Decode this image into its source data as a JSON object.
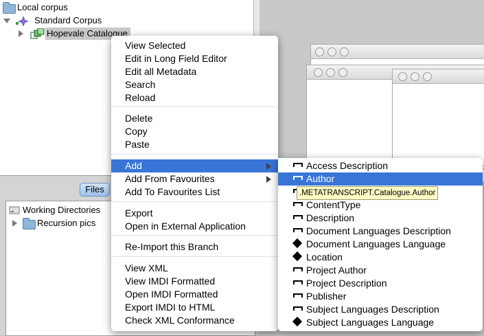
{
  "tree": {
    "root_label": "Local corpus",
    "corpus_label": "Standard Corpus",
    "catalogue_label": "Hopevale Catalogue"
  },
  "files": {
    "tab_label": "Files",
    "working_dirs_label": "Working Directories",
    "recursion_label": "Recursion pics"
  },
  "context_menu": {
    "groups": [
      [
        "View Selected",
        "Edit in Long Field Editor",
        "Edit all Metadata",
        "Search",
        "Reload"
      ],
      [
        "Delete",
        "Copy",
        "Paste"
      ],
      [
        "Add",
        "Add From Favourites",
        "Add To Favourites List"
      ],
      [
        "Export",
        "Open in External Application"
      ],
      [
        "Re-Import this Branch"
      ],
      [
        "View XML",
        "View IMDI Formatted",
        "Open IMDI Formatted",
        "Export IMDI to HTML",
        "Check XML Conformance"
      ]
    ],
    "active_item": "Add",
    "submenu_items": [
      "Add",
      "Add From Favourites"
    ]
  },
  "submenu": {
    "items": [
      {
        "label": "Access Description",
        "icon": "field-icon"
      },
      {
        "label": "Author",
        "icon": "field-icon",
        "active": true
      },
      {
        "label": "",
        "icon": "field-icon"
      },
      {
        "label": "ContentType",
        "icon": "field-icon"
      },
      {
        "label": "Description",
        "icon": "field-icon"
      },
      {
        "label": "Document Languages Description",
        "icon": "field-icon"
      },
      {
        "label": "Document Languages Language",
        "icon": "node-icon"
      },
      {
        "label": "Location",
        "icon": "node-icon"
      },
      {
        "label": "Project Author",
        "icon": "field-icon"
      },
      {
        "label": "Project Description",
        "icon": "field-icon"
      },
      {
        "label": "Publisher",
        "icon": "field-icon"
      },
      {
        "label": "Subject Languages Description",
        "icon": "field-icon"
      },
      {
        "label": "Subject Languages Language",
        "icon": "node-icon"
      }
    ]
  },
  "tooltip": ".METATRANSCRIPT.Catalogue.Author",
  "colors": {
    "highlight": "#3875d7",
    "tooltip_bg": "#fcfcc4",
    "background": "#c9c9c9"
  }
}
